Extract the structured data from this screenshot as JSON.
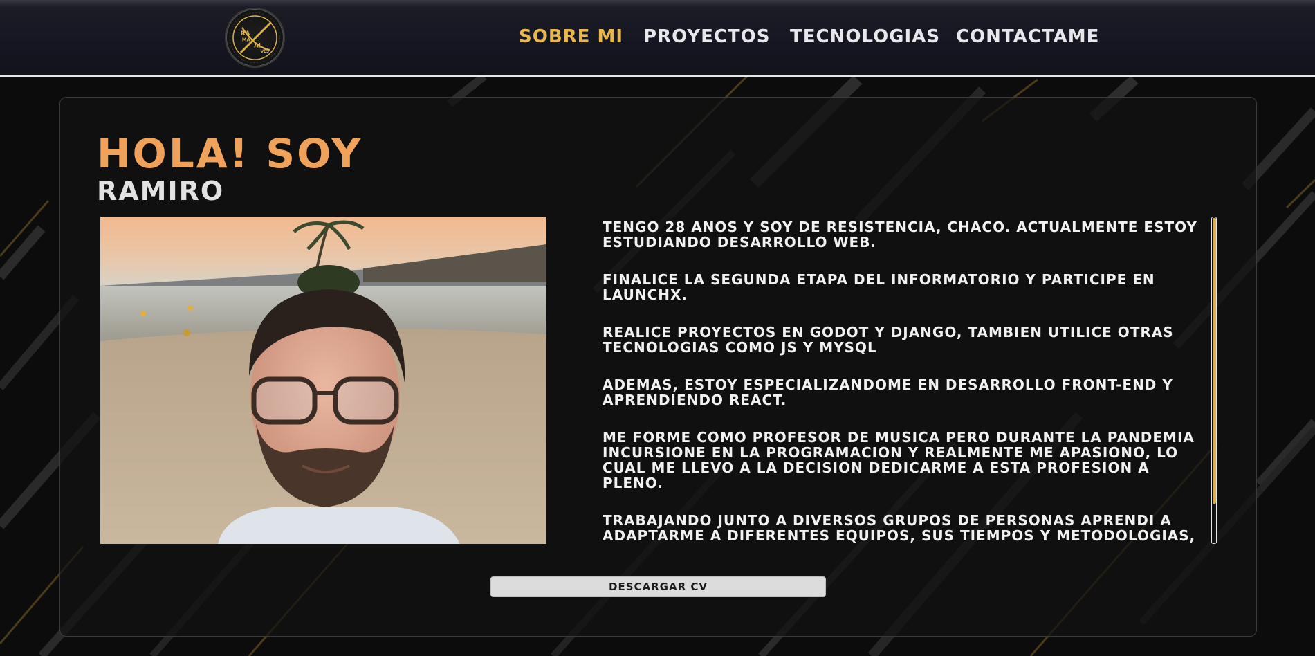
{
  "header": {
    "logo_text": [
      "RA",
      "MA",
      "AL",
      "VES"
    ],
    "nav": [
      {
        "label": "SOBRE MI",
        "active": true
      },
      {
        "label": "PROYECTOS",
        "active": false
      },
      {
        "label": "TECNOLOGIAS",
        "active": false
      },
      {
        "label": "CONTACTAME",
        "active": false
      }
    ]
  },
  "hero": {
    "greeting": "HOLA! SOY",
    "name": "RAMIRO"
  },
  "about": {
    "paragraphs": [
      "Tengo 28 anos y soy de Resistencia, Chaco. Actualmente estoy estudiando desarrollo web.",
      "Finalice la segunda etapa del Informatorio y participe en LaunchX.",
      "Realice proyectos en Godot y Django, tambien utilice otras tecnologias como JS y MySQL",
      "Ademas, estoy especializandome en desarrollo Front-End y aprendiendo React.",
      "Me forme como profesor de musica pero durante la pandemia incursione en la programacion y realmente me apasiono, lo cual me llevo a la decision dedicarme a esta profesion a pleno.",
      "Trabajando junto a diversos grupos de personas aprendi a adaptarme a diferentes equipos, sus tiempos y metodologias, promoviendo un mayor desarrollo personal y"
    ],
    "scroll_position": 0.88
  },
  "cv_button": {
    "label": "DESCARGAR CV"
  },
  "colors": {
    "accent": "#e7b84f",
    "greeting": "#f0a25a",
    "background": "#0c0c0d"
  }
}
